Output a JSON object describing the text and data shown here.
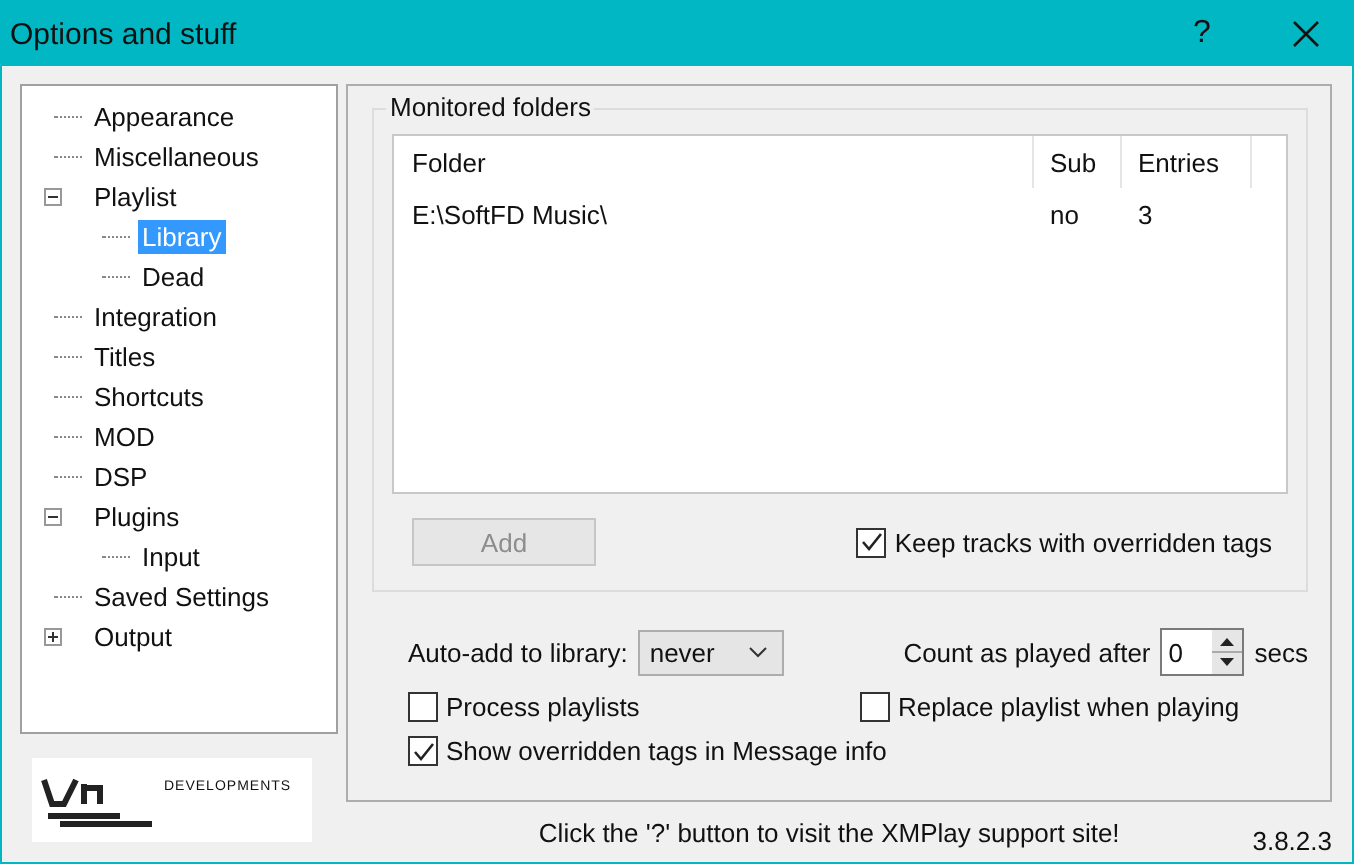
{
  "window": {
    "title": "Options and stuff",
    "help_button": "?"
  },
  "tree": [
    {
      "label": "Appearance",
      "selected": false
    },
    {
      "label": "Miscellaneous",
      "selected": false
    },
    {
      "label": "Playlist",
      "selected": false,
      "expanded": true,
      "children": [
        {
          "label": "Library",
          "selected": true
        },
        {
          "label": "Dead",
          "selected": false
        }
      ]
    },
    {
      "label": "Integration",
      "selected": false
    },
    {
      "label": "Titles",
      "selected": false
    },
    {
      "label": "Shortcuts",
      "selected": false
    },
    {
      "label": "MOD",
      "selected": false
    },
    {
      "label": "DSP",
      "selected": false
    },
    {
      "label": "Plugins",
      "selected": false,
      "expanded": true,
      "children": [
        {
          "label": "Input",
          "selected": false
        }
      ]
    },
    {
      "label": "Saved Settings",
      "selected": false
    },
    {
      "label": "Output",
      "selected": false,
      "expanded": false
    }
  ],
  "logo": {
    "text": "DEVELOPMENTS"
  },
  "monitored": {
    "title": "Monitored folders",
    "columns": [
      "Folder",
      "Sub",
      "Entries"
    ],
    "rows": [
      {
        "cells": [
          "E:\\SoftFD Music\\",
          "no",
          "3"
        ],
        "selected": false
      }
    ],
    "add_button": {
      "label": "Add",
      "disabled": true
    },
    "keep_tracks": {
      "label": "Keep tracks with overridden tags",
      "checked": true
    }
  },
  "auto_add": {
    "label": "Auto-add to library:",
    "value": "never"
  },
  "count_played": {
    "label": "Count as played after",
    "value": "0",
    "unit": "secs"
  },
  "checkboxes": [
    {
      "label": "Process playlists",
      "checked": false
    },
    {
      "label": "Replace playlist when playing",
      "checked": false
    },
    {
      "label": "Show overridden tags in Message info",
      "checked": true
    }
  ],
  "footer": {
    "hint": "Click the '?' button to visit the XMPlay support site!",
    "version": "3.8.2.3"
  }
}
